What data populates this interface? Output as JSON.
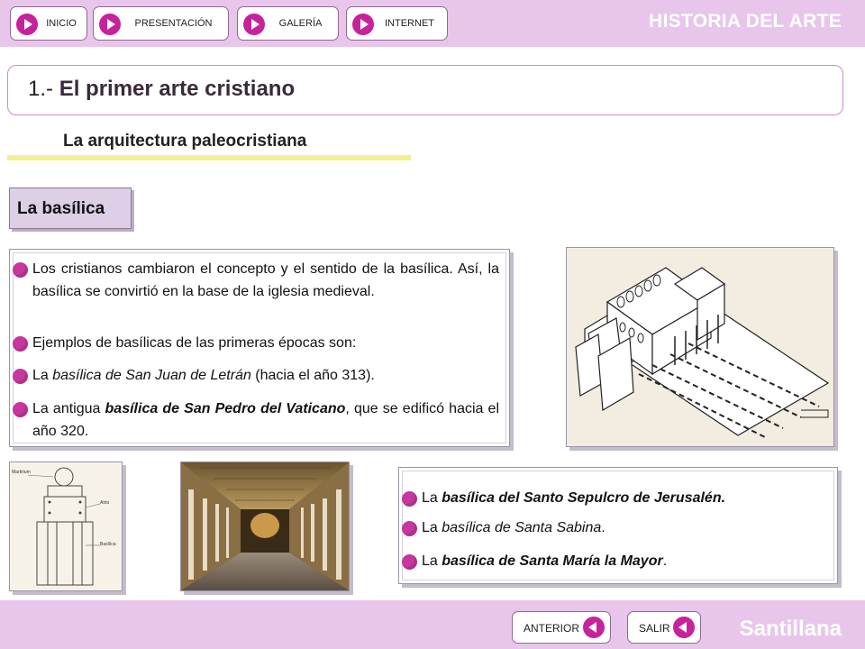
{
  "nav": {
    "items": [
      {
        "label": "INICIO"
      },
      {
        "label": "PRESENTACIÓN"
      },
      {
        "label": "GALERÍA"
      },
      {
        "label": "INTERNET"
      }
    ]
  },
  "brand": {
    "title": "HISTORIA DEL ARTE",
    "publisher": "Santillana"
  },
  "header": {
    "number": "1.- ",
    "title": "El primer arte cristiano"
  },
  "section": {
    "subtitle": "La arquitectura paleocristiana",
    "tag": "La basílica"
  },
  "main_panel": {
    "p1": "Los cristianos cambiaron el concepto y el sentido de la basílica. Así, la basílica se convirtió en la base de la iglesia medieval.",
    "p2": "Ejemplos de basílicas de las primeras épocas son:",
    "p3_a": "La ",
    "p3_b": "basílica de  San Juan  de Letrán",
    "p3_c": " (hacia el año 313).",
    "p4_a": "La antigua ",
    "p4_b": "basílica de San Pedro del Vaticano",
    "p4_c": ", que se edificó hacia el año 320."
  },
  "side_panel": {
    "i1_a": "La ",
    "i1_b": "basílica del Santo Sepulcro de Jerusalén.",
    "i2_a": "La ",
    "i2_b": "basílica de Santa Sabina",
    "i2_c": ".",
    "i3_a": "La ",
    "i3_b": "basílica de Santa María la Mayor",
    "i3_c": "."
  },
  "plan_labels": {
    "l1": "Martirium",
    "l2": "Atrio",
    "l3": "Basílica"
  },
  "footer": {
    "prev": "ANTERIOR",
    "exit": "SALIR"
  },
  "colors": {
    "bar": "#e8c6ec",
    "bullet": "#c6389e",
    "underline": "#f3f08f",
    "tag": "#dccfe6"
  }
}
